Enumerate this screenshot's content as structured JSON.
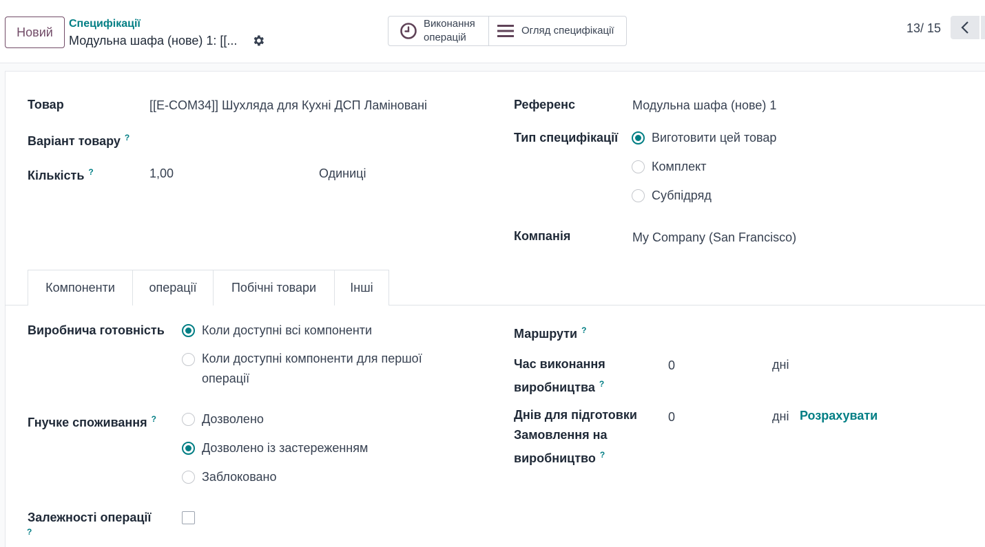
{
  "header": {
    "new_button": "Новий",
    "breadcrumb_parent": "Специфікації",
    "breadcrumb_current": "Модульна шафа (нове) 1: [[...",
    "smart_buttons": [
      {
        "label": "Виконання операцій",
        "icon": "clock-icon"
      },
      {
        "label": "Огляд специфікації",
        "icon": "list-icon"
      }
    ],
    "pager": "13/ 15"
  },
  "form": {
    "product": {
      "label": "Товар",
      "value": "[[E-COM34]] Шухляда для Кухні ДСП Ламіновані"
    },
    "variant": {
      "label": "Варіант товару",
      "help": "?"
    },
    "quantity": {
      "label": "Кількість",
      "help": "?",
      "value": "1,00",
      "uom": "Одиниці"
    },
    "reference": {
      "label": "Референс",
      "value": "Модульна шафа (нове) 1"
    },
    "bom_type": {
      "label": "Тип специфікації",
      "options": [
        "Виготовити цей товар",
        "Комплект",
        "Субпідряд"
      ],
      "selected": "Виготовити цей товар"
    },
    "company": {
      "label": "Компанія",
      "value": "My Company (San Francisco)"
    }
  },
  "tabs": [
    "Компоненти",
    "операції",
    "Побічні товари",
    "Інші"
  ],
  "active_tab": "Інші",
  "other": {
    "readiness": {
      "label": "Виробнича готовність",
      "options": [
        "Коли доступні всі компоненти",
        "Коли доступні компоненти для першої",
        "операції"
      ],
      "selected": "Коли доступні всі компоненти"
    },
    "flexible": {
      "label": "Гнучке споживання",
      "help": "?",
      "options": [
        "Дозволено",
        "Дозволено із застереженням",
        "Заблоковано"
      ],
      "selected": "Дозволено із застереженням"
    },
    "dependencies": {
      "label": "Залежності операції",
      "help": "?",
      "checked": false
    },
    "routes": {
      "label": "Маршрути",
      "help": "?"
    },
    "lead_time": {
      "label_line1": "Час виконання",
      "label_line2": "виробництва",
      "help": "?",
      "value": "0",
      "unit": "дні"
    },
    "prep_days": {
      "label_line1": "Днів для підготовки",
      "label_line2": "Замовлення на",
      "label_line3": "виробництво",
      "help": "?",
      "value": "0",
      "unit": "дні",
      "action": "Розрахувати"
    }
  },
  "colors": {
    "primary": "#714b67",
    "accent": "#017e84"
  }
}
